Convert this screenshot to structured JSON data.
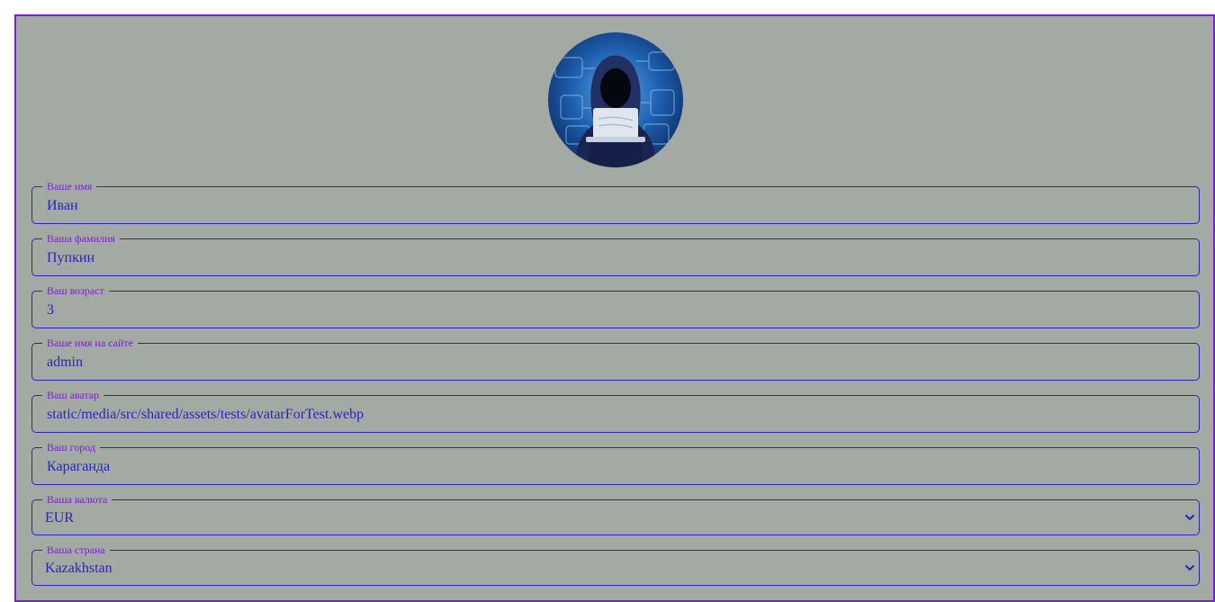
{
  "profile": {
    "avatar_icon": "hooded-hacker-avatar",
    "fields": [
      {
        "label": "Ваше имя",
        "value": "Иван"
      },
      {
        "label": "Ваша фамилия",
        "value": "Пупкин"
      },
      {
        "label": "Ваш возраст",
        "value": "3"
      },
      {
        "label": "Ваше имя на сайте",
        "value": "admin"
      },
      {
        "label": "Ваш аватар",
        "value": "static/media/src/shared/assets/tests/avatarForTest.webp"
      },
      {
        "label": "Ваш город",
        "value": "Караганда"
      }
    ],
    "currency": {
      "label": "Ваша валюта",
      "value": "EUR"
    },
    "country": {
      "label": "Ваша страна",
      "value": "Kazakhstan"
    }
  },
  "colors": {
    "card_bg": "#a3aaa3",
    "border_purple": "#7a1fd6",
    "text_blue": "#2b24b8"
  }
}
